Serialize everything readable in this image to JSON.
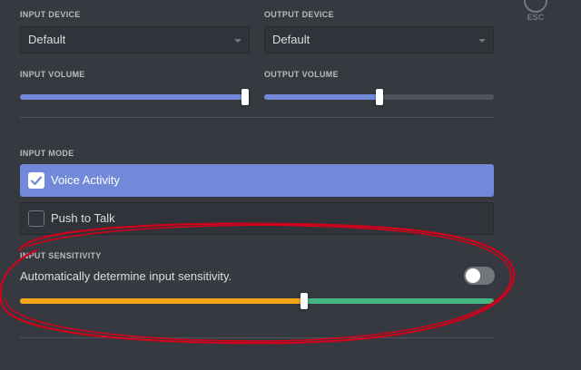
{
  "close": {
    "esc_label": "ESC"
  },
  "input_device": {
    "label": "INPUT DEVICE",
    "value": "Default"
  },
  "output_device": {
    "label": "OUTPUT DEVICE",
    "value": "Default"
  },
  "input_volume": {
    "label": "INPUT VOLUME",
    "level": 1.0
  },
  "output_volume": {
    "label": "OUTPUT VOLUME",
    "level": 0.5
  },
  "input_mode": {
    "label": "INPUT MODE",
    "options": [
      {
        "label": "Voice Activity",
        "selected": true
      },
      {
        "label": "Push to Talk",
        "selected": false
      }
    ]
  },
  "input_sensitivity": {
    "label": "INPUT SENSITIVITY",
    "auto_label": "Automatically determine input sensitivity.",
    "auto_enabled": false,
    "threshold": 0.6
  },
  "colors": {
    "accent": "#7289da",
    "sensitivity_low": "#faa61a",
    "sensitivity_high": "#43b581",
    "annotation_ring": "#d0021b"
  }
}
